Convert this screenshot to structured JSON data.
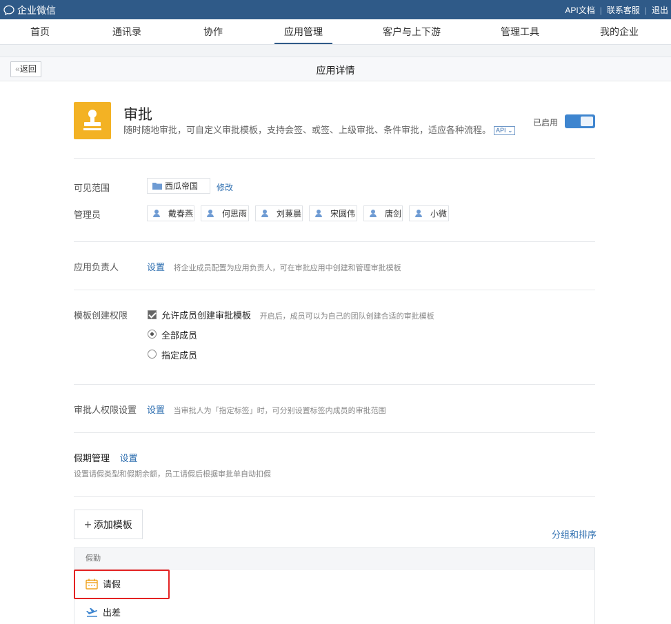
{
  "topbar": {
    "brand": "企业微信",
    "links": [
      "API文档",
      "联系客服",
      "退出"
    ],
    "separator": "|"
  },
  "nav": {
    "tabs": [
      "首页",
      "通讯录",
      "协作",
      "应用管理",
      "客户与上下游",
      "管理工具",
      "我的企业"
    ],
    "active": "应用管理"
  },
  "subheader": {
    "back": "返回",
    "title": "应用详情"
  },
  "app": {
    "name": "审批",
    "description": "随时随地审批，可自定义审批模板，支持会签、或签、上级审批、条件审批，适应各种流程。",
    "api_tag": "API",
    "status_label": "已启用",
    "enabled": true,
    "icon": "stamp-icon",
    "icon_color": "#f3b224"
  },
  "visibility": {
    "label": "可见范围",
    "value": "西瓜帝国",
    "edit": "修改"
  },
  "admins": {
    "label": "管理员",
    "names": [
      "戴春燕",
      "何思雨",
      "刘蒹晨",
      "宋圆伟",
      "唐剑",
      "小微"
    ]
  },
  "owner": {
    "label": "应用负责人",
    "action": "设置",
    "hint": "将企业成员配置为应用负责人，可在审批应用中创建和管理审批模板"
  },
  "template_permission": {
    "label": "模板创建权限",
    "checkbox_label": "允许成员创建审批模板",
    "checked": true,
    "hint": "开启后，成员可以为自己的团队创建合适的审批模板",
    "options": [
      "全部成员",
      "指定成员"
    ],
    "selected": "全部成员"
  },
  "approver_permission": {
    "label": "审批人权限设置",
    "action": "设置",
    "hint": "当审批人为「指定标签」时，可分别设置标签内成员的审批范围"
  },
  "leave": {
    "label": "假期管理",
    "action": "设置",
    "hint": "设置请假类型和假期余额，员工请假后根据审批单自动扣假"
  },
  "templates": {
    "add": "添加模板",
    "group_sort": "分组和排序",
    "group": "假勤",
    "items": [
      "请假",
      "出差"
    ]
  },
  "colors": {
    "topbar": "#2f5a88",
    "link": "#2f6fb0",
    "toggle": "#3e85cf",
    "highlight": "#e32222"
  }
}
